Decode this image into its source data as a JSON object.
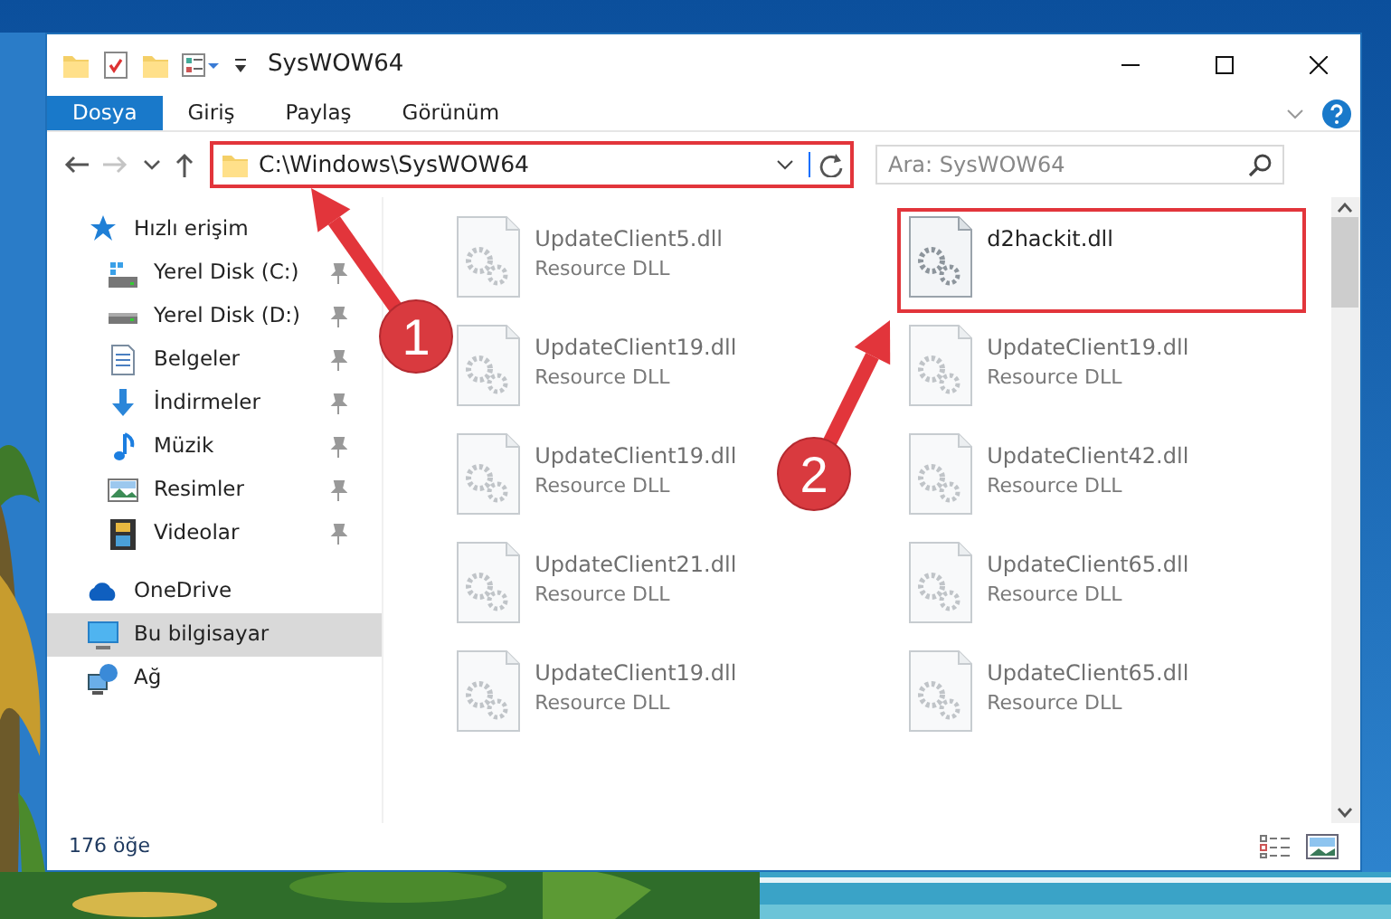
{
  "window": {
    "title": "SysWOW64"
  },
  "ribbon_tabs": [
    {
      "label": "Dosya",
      "selected": true
    },
    {
      "label": "Giriş",
      "selected": false
    },
    {
      "label": "Paylaş",
      "selected": false
    },
    {
      "label": "Görünüm",
      "selected": false
    }
  ],
  "nav_buttons": [
    {
      "kind": "back",
      "disabled": false
    },
    {
      "kind": "forward",
      "disabled": true
    },
    {
      "kind": "recent",
      "disabled": false
    },
    {
      "kind": "up",
      "disabled": false
    }
  ],
  "address": {
    "path": "C:\\Windows\\SysWOW64",
    "highlighted": true
  },
  "search": {
    "placeholder": "Ara: SysWOW64"
  },
  "sidebar": {
    "items": [
      {
        "label": "Hızlı erişim",
        "kind": "star",
        "selected": false,
        "children": [
          {
            "label": "Yerel Disk (C:)",
            "kind": "drive-win",
            "pinned": true
          },
          {
            "label": "Yerel Disk (D:)",
            "kind": "drive",
            "pinned": true
          },
          {
            "label": "Belgeler",
            "kind": "docs",
            "pinned": true
          },
          {
            "label": "İndirmeler",
            "kind": "download",
            "pinned": true
          },
          {
            "label": "Müzik",
            "kind": "music",
            "pinned": true
          },
          {
            "label": "Resimler",
            "kind": "pictures",
            "pinned": true
          },
          {
            "label": "Videolar",
            "kind": "videos",
            "pinned": true
          }
        ]
      },
      {
        "label": "OneDrive",
        "kind": "cloud",
        "selected": false
      },
      {
        "label": "Bu bilgisayar",
        "kind": "pc",
        "selected": true
      },
      {
        "label": "Ağ",
        "kind": "network",
        "selected": false
      }
    ]
  },
  "files": [
    {
      "name": "UpdateClient5.dll",
      "type": "Resource DLL",
      "blurred": true,
      "highlighted": false
    },
    {
      "name": "d2hackit.dll",
      "blurred": false,
      "highlighted": true
    },
    {
      "name": "UpdateClient19.dll",
      "type": "Resource DLL",
      "blurred": true,
      "highlighted": false
    },
    {
      "name": "UpdateClient19.dll",
      "type": "Resource DLL",
      "blurred": true,
      "highlighted": false
    },
    {
      "name": "UpdateClient19.dll",
      "type": "Resource DLL",
      "blurred": true,
      "highlighted": false
    },
    {
      "name": "UpdateClient42.dll",
      "type": "Resource DLL",
      "blurred": true,
      "highlighted": false
    },
    {
      "name": "UpdateClient21.dll",
      "type": "Resource DLL",
      "blurred": true,
      "highlighted": false
    },
    {
      "name": "UpdateClient65.dll",
      "type": "Resource DLL",
      "blurred": true,
      "highlighted": false
    },
    {
      "name": "UpdateClient19.dll",
      "type": "Resource DLL",
      "blurred": true,
      "highlighted": false
    },
    {
      "name": "UpdateClient65.dll",
      "type": "Resource DLL",
      "blurred": true,
      "highlighted": false
    }
  ],
  "status_bar": {
    "item_count": "176 öğe"
  },
  "annotations": [
    {
      "number": "1"
    },
    {
      "number": "2"
    }
  ]
}
